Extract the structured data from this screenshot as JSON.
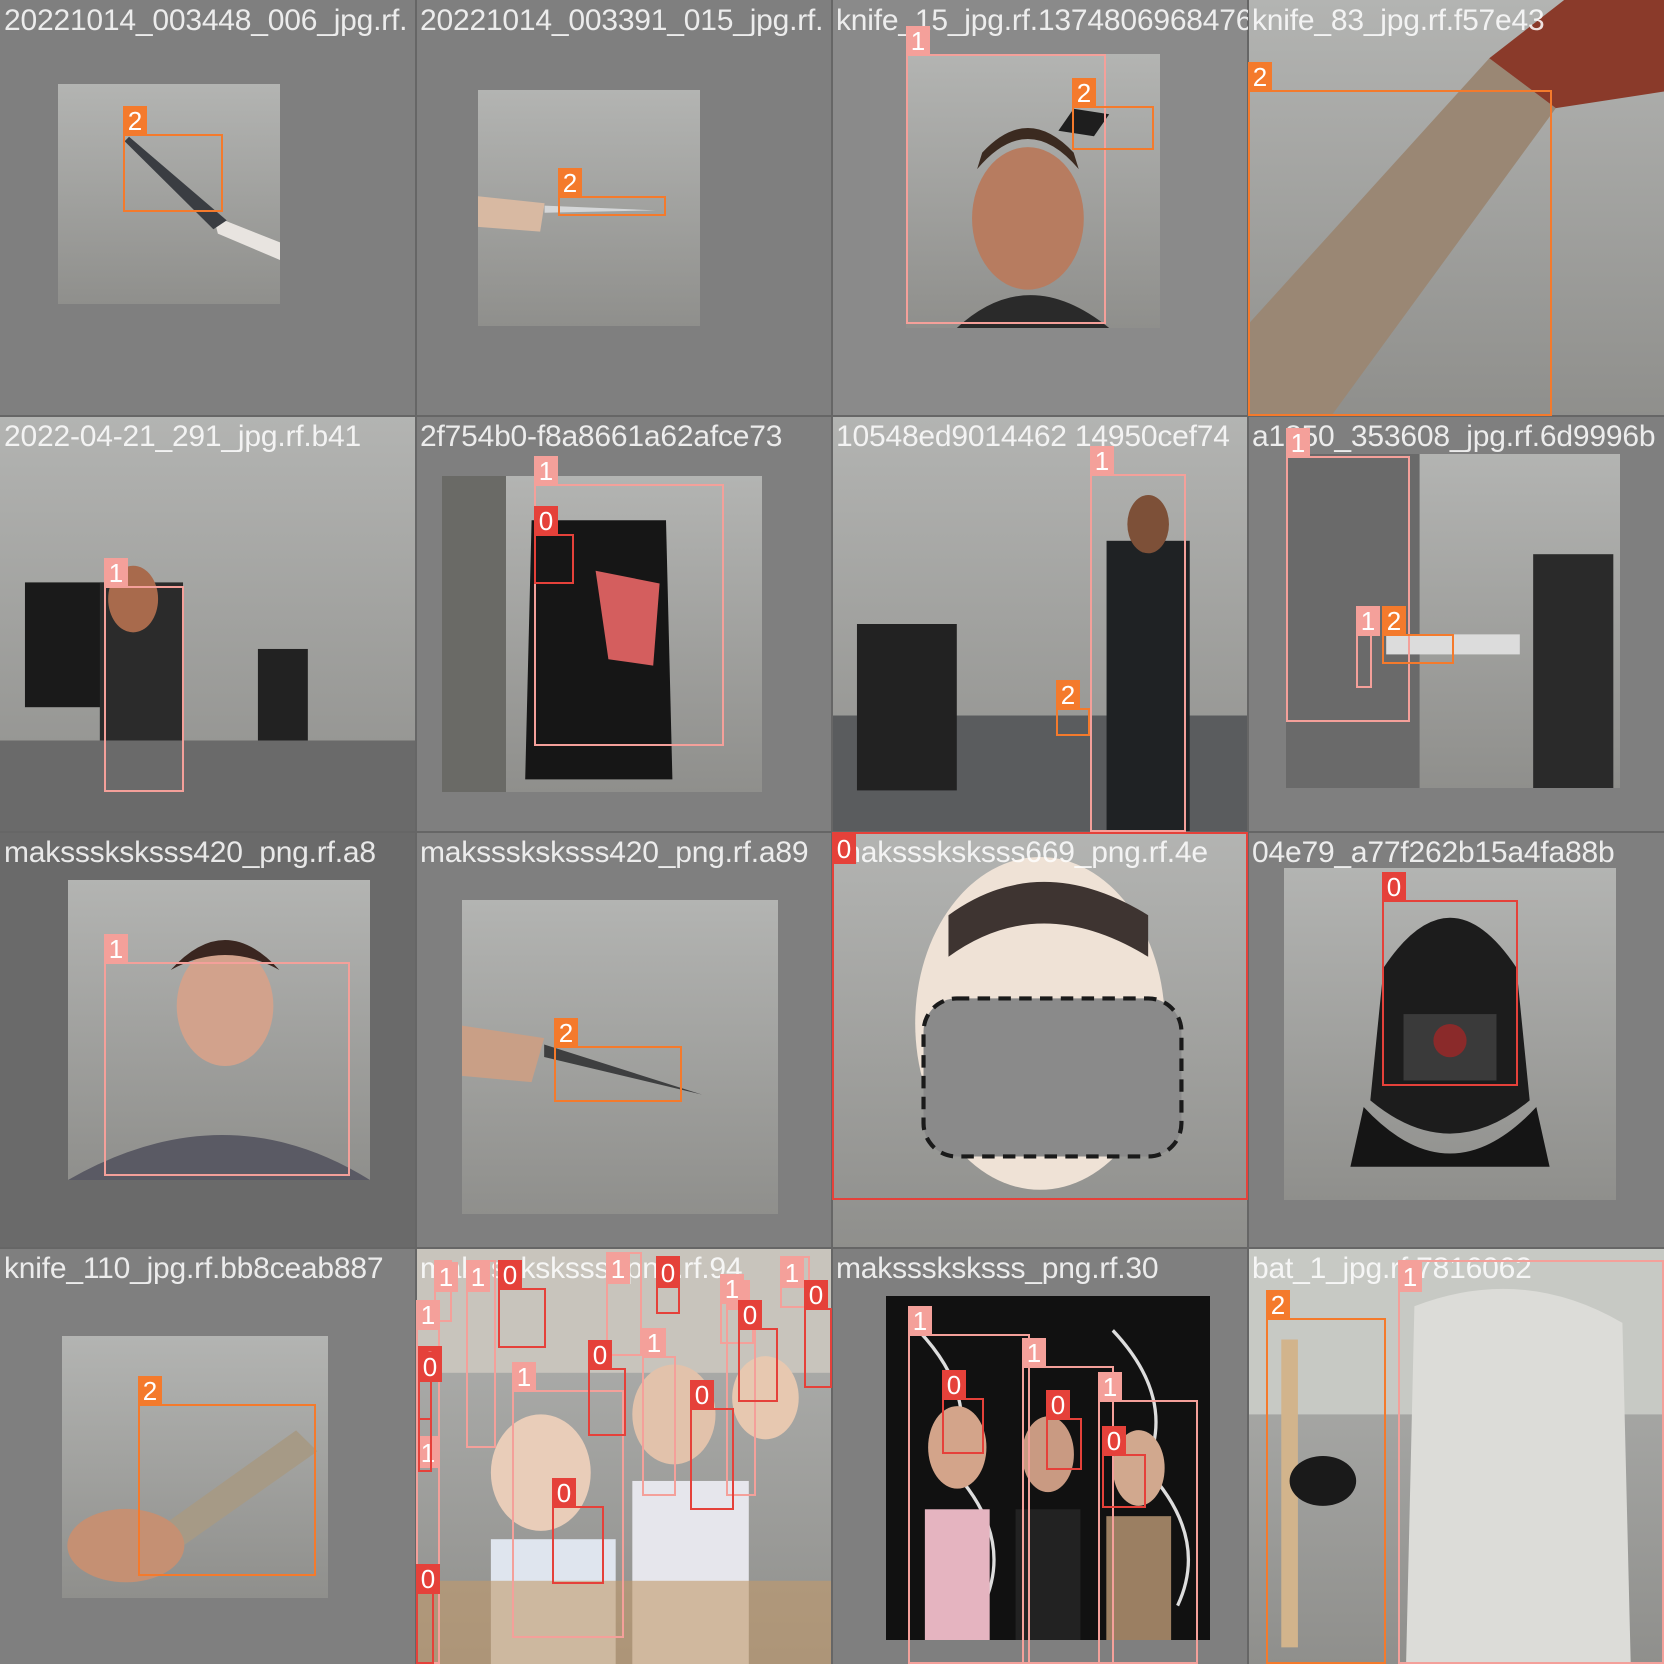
{
  "mosaic": {
    "tiles": [
      {
        "filename": "20221014_003448_006_jpg.rf.",
        "scene": "hand holding knife, grey wall",
        "boxes": [
          {
            "cls": "2"
          }
        ]
      },
      {
        "filename": "20221014_003391_015_jpg.rf.",
        "scene": "hand holding thin knife, grey wall",
        "boxes": [
          {
            "cls": "2"
          }
        ]
      },
      {
        "filename": "knife_15_jpg.rf.1374806968476",
        "scene": "man raising knife",
        "boxes": [
          {
            "cls": "1"
          },
          {
            "cls": "2"
          }
        ]
      },
      {
        "filename": "knife_83_jpg.rf.f57e43",
        "scene": "close-up kitchen knife",
        "boxes": [
          {
            "cls": "2"
          }
        ]
      },
      {
        "filename": "2022-04-21_291_jpg.rf.b41",
        "scene": "man at desk, office",
        "boxes": [
          {
            "cls": "1"
          }
        ]
      },
      {
        "filename": "2f754b0-f8a8661a62afce73",
        "scene": "hooded robber, restaurant",
        "boxes": [
          {
            "cls": "1"
          },
          {
            "cls": "0"
          }
        ]
      },
      {
        "filename": "10548ed9014462 14950cef74",
        "scene": "man standing with knife, office",
        "boxes": [
          {
            "cls": "1"
          },
          {
            "cls": "2"
          }
        ]
      },
      {
        "filename": "a1850_353608_jpg.rf.6d9996b",
        "scene": "cctv office with knife",
        "boxes": [
          {
            "cls": "1"
          },
          {
            "cls": "1"
          },
          {
            "cls": "2"
          }
        ]
      },
      {
        "filename": "maksssksksss420_png.rf.a8",
        "scene": "young man selfie",
        "boxes": [
          {
            "cls": "1"
          }
        ]
      },
      {
        "filename": "maksssksksss420_png.rf.a89",
        "scene": "hand with knife, grey wall",
        "boxes": [
          {
            "cls": "2"
          }
        ]
      },
      {
        "filename": "maksssksksss669_png.rf.4e",
        "scene": "person with checked face mask",
        "boxes": [
          {
            "cls": "0"
          }
        ]
      },
      {
        "filename": "04e79_a77f262b15a4fa88b",
        "scene": "balaclava product",
        "boxes": [
          {
            "cls": "0"
          }
        ]
      },
      {
        "filename": "knife_110_jpg.rf.bb8ceab887",
        "scene": "hand holding large knife",
        "boxes": [
          {
            "cls": "2"
          }
        ]
      },
      {
        "filename": "maksssksksss_png.rf.94",
        "scene": "classroom students wearing masks",
        "boxes": [
          {
            "cls": "1"
          },
          {
            "cls": "1"
          },
          {
            "cls": "1"
          },
          {
            "cls": "1"
          },
          {
            "cls": "1"
          },
          {
            "cls": "1"
          },
          {
            "cls": "1"
          },
          {
            "cls": "1"
          },
          {
            "cls": "1"
          },
          {
            "cls": "1"
          },
          {
            "cls": "0"
          },
          {
            "cls": "0"
          },
          {
            "cls": "0"
          },
          {
            "cls": "0"
          },
          {
            "cls": "0"
          },
          {
            "cls": "0"
          },
          {
            "cls": "0"
          },
          {
            "cls": "0"
          },
          {
            "cls": "0"
          },
          {
            "cls": "0"
          }
        ]
      },
      {
        "filename": "maksssksksss_png.rf.30",
        "scene": "group wearing masks",
        "boxes": [
          {
            "cls": "1"
          },
          {
            "cls": "1"
          },
          {
            "cls": "1"
          },
          {
            "cls": "0"
          },
          {
            "cls": "0"
          },
          {
            "cls": "0"
          }
        ]
      },
      {
        "filename": "bat_1_jpg.rf.7816062",
        "scene": "baseball player with bat",
        "boxes": [
          {
            "cls": "2"
          },
          {
            "cls": "1"
          }
        ]
      }
    ]
  }
}
